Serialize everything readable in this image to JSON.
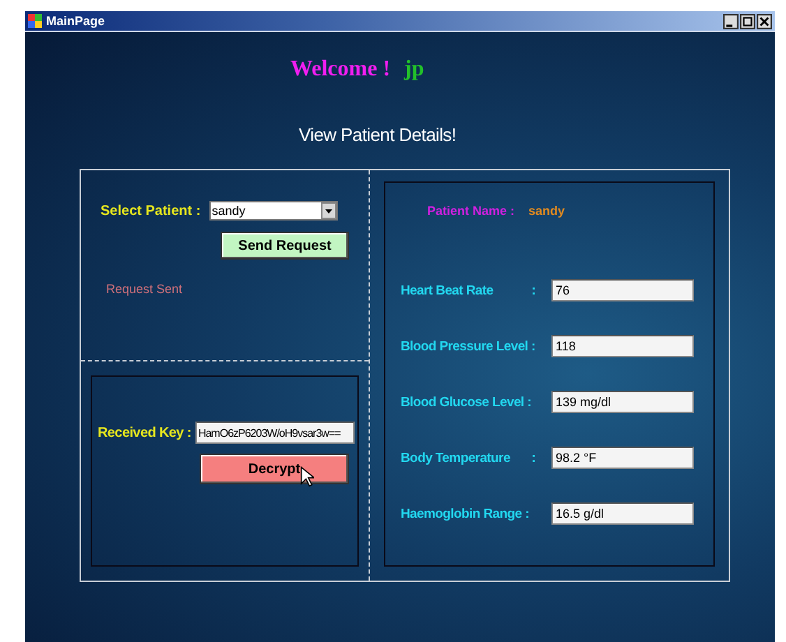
{
  "window": {
    "title": "MainPage"
  },
  "welcome": {
    "greeting": "Welcome !",
    "user": "jp"
  },
  "heading": "View Patient Details!",
  "request": {
    "label": "Select Patient :",
    "patient": "sandy",
    "button": "Send Request",
    "status": "Request Sent"
  },
  "key": {
    "label": "Received Key :",
    "value": "HamO6zP6203W/oH9vsar3w==",
    "button": "Decrypt"
  },
  "details": {
    "name_label": "Patient Name :",
    "name_value": "sandy",
    "fields": [
      {
        "label": "Heart Beat Rate",
        "colon": ":",
        "value": "76"
      },
      {
        "label": "Blood Pressure Level :",
        "value": "118"
      },
      {
        "label": "Blood Glucose Level  :",
        "value": "139 mg/dl"
      },
      {
        "label": "Body Temperature",
        "colon": ":",
        "value": "98.2 °F"
      },
      {
        "label": "Haemoglobin Range :",
        "value": "16.5 g/dl"
      }
    ]
  }
}
